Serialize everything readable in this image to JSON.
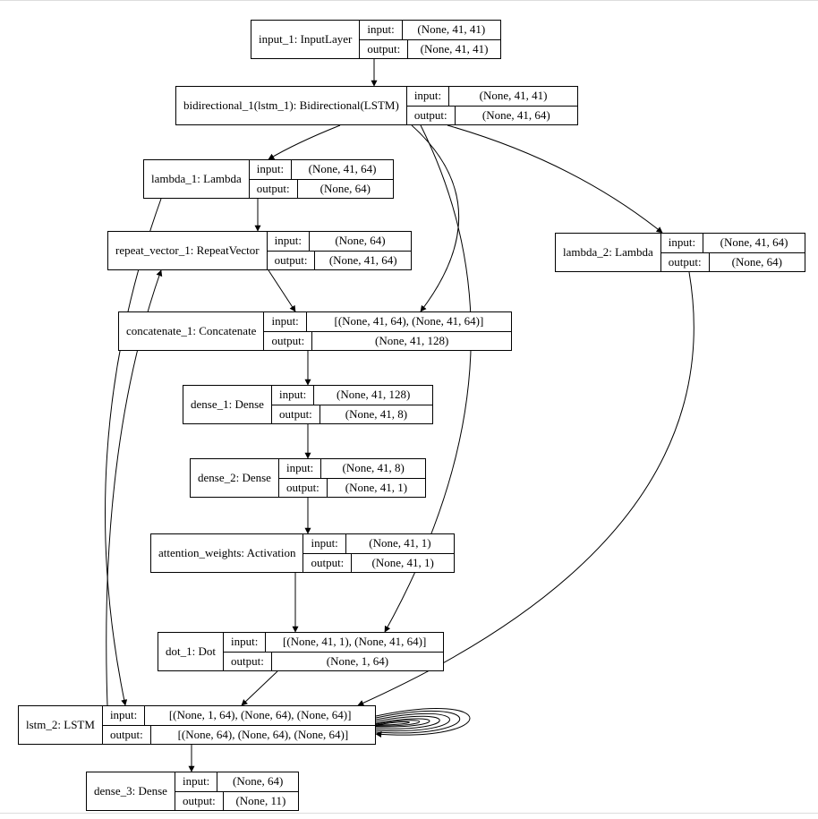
{
  "labels": {
    "input": "input:",
    "output": "output:"
  },
  "nodes": {
    "input_1": {
      "name": "input_1: InputLayer",
      "in": "(None, 41, 41)",
      "out": "(None, 41, 41)"
    },
    "bidir": {
      "name": "bidirectional_1(lstm_1): Bidirectional(LSTM)",
      "in": "(None, 41, 41)",
      "out": "(None, 41, 64)"
    },
    "lambda_1": {
      "name": "lambda_1: Lambda",
      "in": "(None, 41, 64)",
      "out": "(None, 64)"
    },
    "lambda_2": {
      "name": "lambda_2: Lambda",
      "in": "(None, 41, 64)",
      "out": "(None, 64)"
    },
    "repeat": {
      "name": "repeat_vector_1: RepeatVector",
      "in": "(None, 64)",
      "out": "(None, 41, 64)"
    },
    "concat": {
      "name": "concatenate_1: Concatenate",
      "in": "[(None, 41, 64), (None, 41, 64)]",
      "out": "(None, 41, 128)"
    },
    "dense_1": {
      "name": "dense_1: Dense",
      "in": "(None, 41, 128)",
      "out": "(None, 41, 8)"
    },
    "dense_2": {
      "name": "dense_2: Dense",
      "in": "(None, 41, 8)",
      "out": "(None, 41, 1)"
    },
    "attn": {
      "name": "attention_weights: Activation",
      "in": "(None, 41, 1)",
      "out": "(None, 41, 1)"
    },
    "dot": {
      "name": "dot_1: Dot",
      "in": "[(None, 41, 1), (None, 41, 64)]",
      "out": "(None, 1, 64)"
    },
    "lstm_2": {
      "name": "lstm_2: LSTM",
      "in": "[(None, 1, 64), (None, 64), (None, 64)]",
      "out": "[(None, 64), (None, 64), (None, 64)]"
    },
    "dense_3": {
      "name": "dense_3: Dense",
      "in": "(None, 64)",
      "out": "(None, 11)"
    }
  },
  "chart_data": {
    "type": "diagram",
    "title": "",
    "graph_type": "keras_model_plot",
    "nodes": [
      {
        "id": "input_1",
        "label": "input_1: InputLayer",
        "input_shape": "(None, 41, 41)",
        "output_shape": "(None, 41, 41)"
      },
      {
        "id": "bidirectional_1",
        "label": "bidirectional_1(lstm_1): Bidirectional(LSTM)",
        "input_shape": "(None, 41, 41)",
        "output_shape": "(None, 41, 64)"
      },
      {
        "id": "lambda_1",
        "label": "lambda_1: Lambda",
        "input_shape": "(None, 41, 64)",
        "output_shape": "(None, 64)"
      },
      {
        "id": "lambda_2",
        "label": "lambda_2: Lambda",
        "input_shape": "(None, 41, 64)",
        "output_shape": "(None, 64)"
      },
      {
        "id": "repeat_vector_1",
        "label": "repeat_vector_1: RepeatVector",
        "input_shape": "(None, 64)",
        "output_shape": "(None, 41, 64)"
      },
      {
        "id": "concatenate_1",
        "label": "concatenate_1: Concatenate",
        "input_shape": "[(None, 41, 64), (None, 41, 64)]",
        "output_shape": "(None, 41, 128)"
      },
      {
        "id": "dense_1",
        "label": "dense_1: Dense",
        "input_shape": "(None, 41, 128)",
        "output_shape": "(None, 41, 8)"
      },
      {
        "id": "dense_2",
        "label": "dense_2: Dense",
        "input_shape": "(None, 41, 8)",
        "output_shape": "(None, 41, 1)"
      },
      {
        "id": "attention_weights",
        "label": "attention_weights: Activation",
        "input_shape": "(None, 41, 1)",
        "output_shape": "(None, 41, 1)"
      },
      {
        "id": "dot_1",
        "label": "dot_1: Dot",
        "input_shape": "[(None, 41, 1), (None, 41, 64)]",
        "output_shape": "(None, 1, 64)"
      },
      {
        "id": "lstm_2",
        "label": "lstm_2: LSTM",
        "input_shape": "[(None, 1, 64), (None, 64), (None, 64)]",
        "output_shape": "[(None, 64), (None, 64), (None, 64)]"
      },
      {
        "id": "dense_3",
        "label": "dense_3: Dense",
        "input_shape": "(None, 64)",
        "output_shape": "(None, 11)"
      }
    ],
    "edges": [
      {
        "from": "input_1",
        "to": "bidirectional_1"
      },
      {
        "from": "bidirectional_1",
        "to": "lambda_1"
      },
      {
        "from": "bidirectional_1",
        "to": "lambda_2"
      },
      {
        "from": "bidirectional_1",
        "to": "concatenate_1"
      },
      {
        "from": "bidirectional_1",
        "to": "dot_1"
      },
      {
        "from": "lambda_1",
        "to": "repeat_vector_1"
      },
      {
        "from": "lambda_1",
        "to": "lstm_2"
      },
      {
        "from": "lambda_2",
        "to": "lstm_2"
      },
      {
        "from": "repeat_vector_1",
        "to": "concatenate_1"
      },
      {
        "from": "concatenate_1",
        "to": "dense_1"
      },
      {
        "from": "dense_1",
        "to": "dense_2"
      },
      {
        "from": "dense_2",
        "to": "attention_weights"
      },
      {
        "from": "attention_weights",
        "to": "dot_1"
      },
      {
        "from": "dot_1",
        "to": "lstm_2"
      },
      {
        "from": "lstm_2",
        "to": "dense_3"
      },
      {
        "from": "lstm_2",
        "to": "repeat_vector_1"
      },
      {
        "from": "lstm_2",
        "to": "lstm_2",
        "self_loop": true
      }
    ]
  }
}
